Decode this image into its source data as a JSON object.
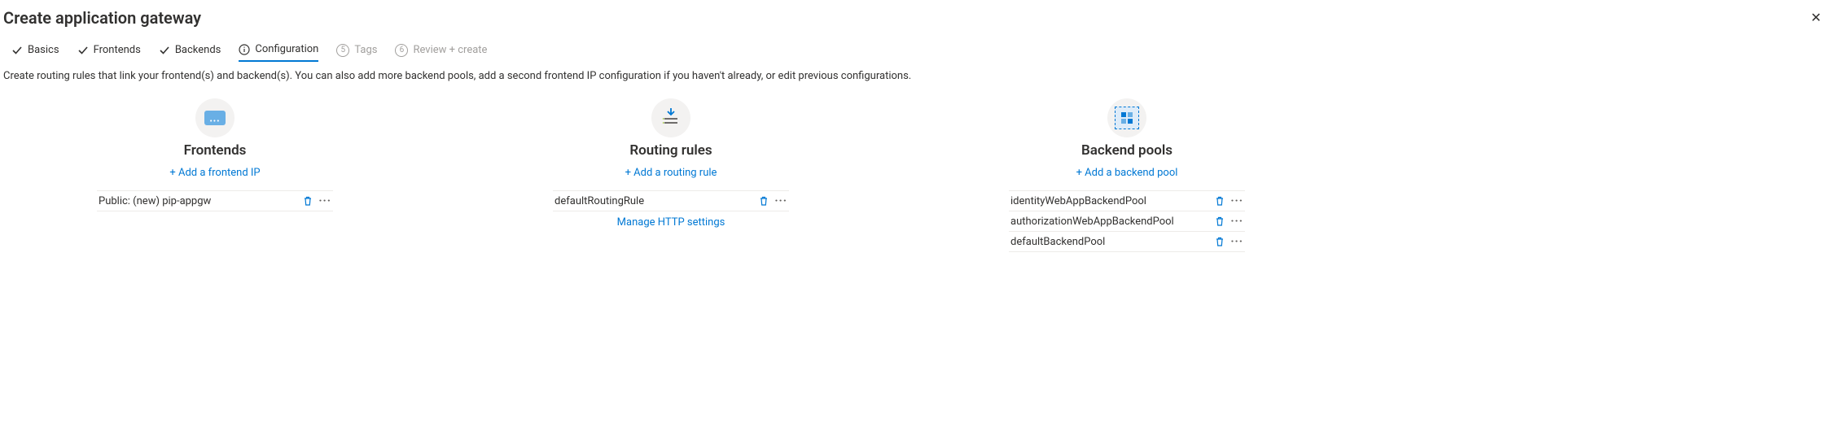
{
  "header": {
    "title": "Create application gateway",
    "close_label": "✕"
  },
  "tabs": {
    "basics": "Basics",
    "frontends": "Frontends",
    "backends": "Backends",
    "configuration": "Configuration",
    "tags_num": "5",
    "tags": "Tags",
    "review_num": "6",
    "review": "Review + create"
  },
  "description": "Create routing rules that link your frontend(s) and backend(s). You can also add more backend pools, add a second frontend IP configuration if you haven't already, or edit previous configurations.",
  "columns": {
    "frontends": {
      "title": "Frontends",
      "add": "+ Add a frontend IP",
      "items": [
        {
          "label": "Public: (new) pip-appgw"
        }
      ]
    },
    "routing": {
      "title": "Routing rules",
      "add": "+ Add a routing rule",
      "items": [
        {
          "label": "defaultRoutingRule"
        }
      ],
      "sublink": "Manage HTTP settings"
    },
    "backendpools": {
      "title": "Backend pools",
      "add": "+ Add a backend pool",
      "items": [
        {
          "label": "identityWebAppBackendPool"
        },
        {
          "label": "authorizationWebAppBackendPool"
        },
        {
          "label": "defaultBackendPool"
        }
      ]
    }
  }
}
